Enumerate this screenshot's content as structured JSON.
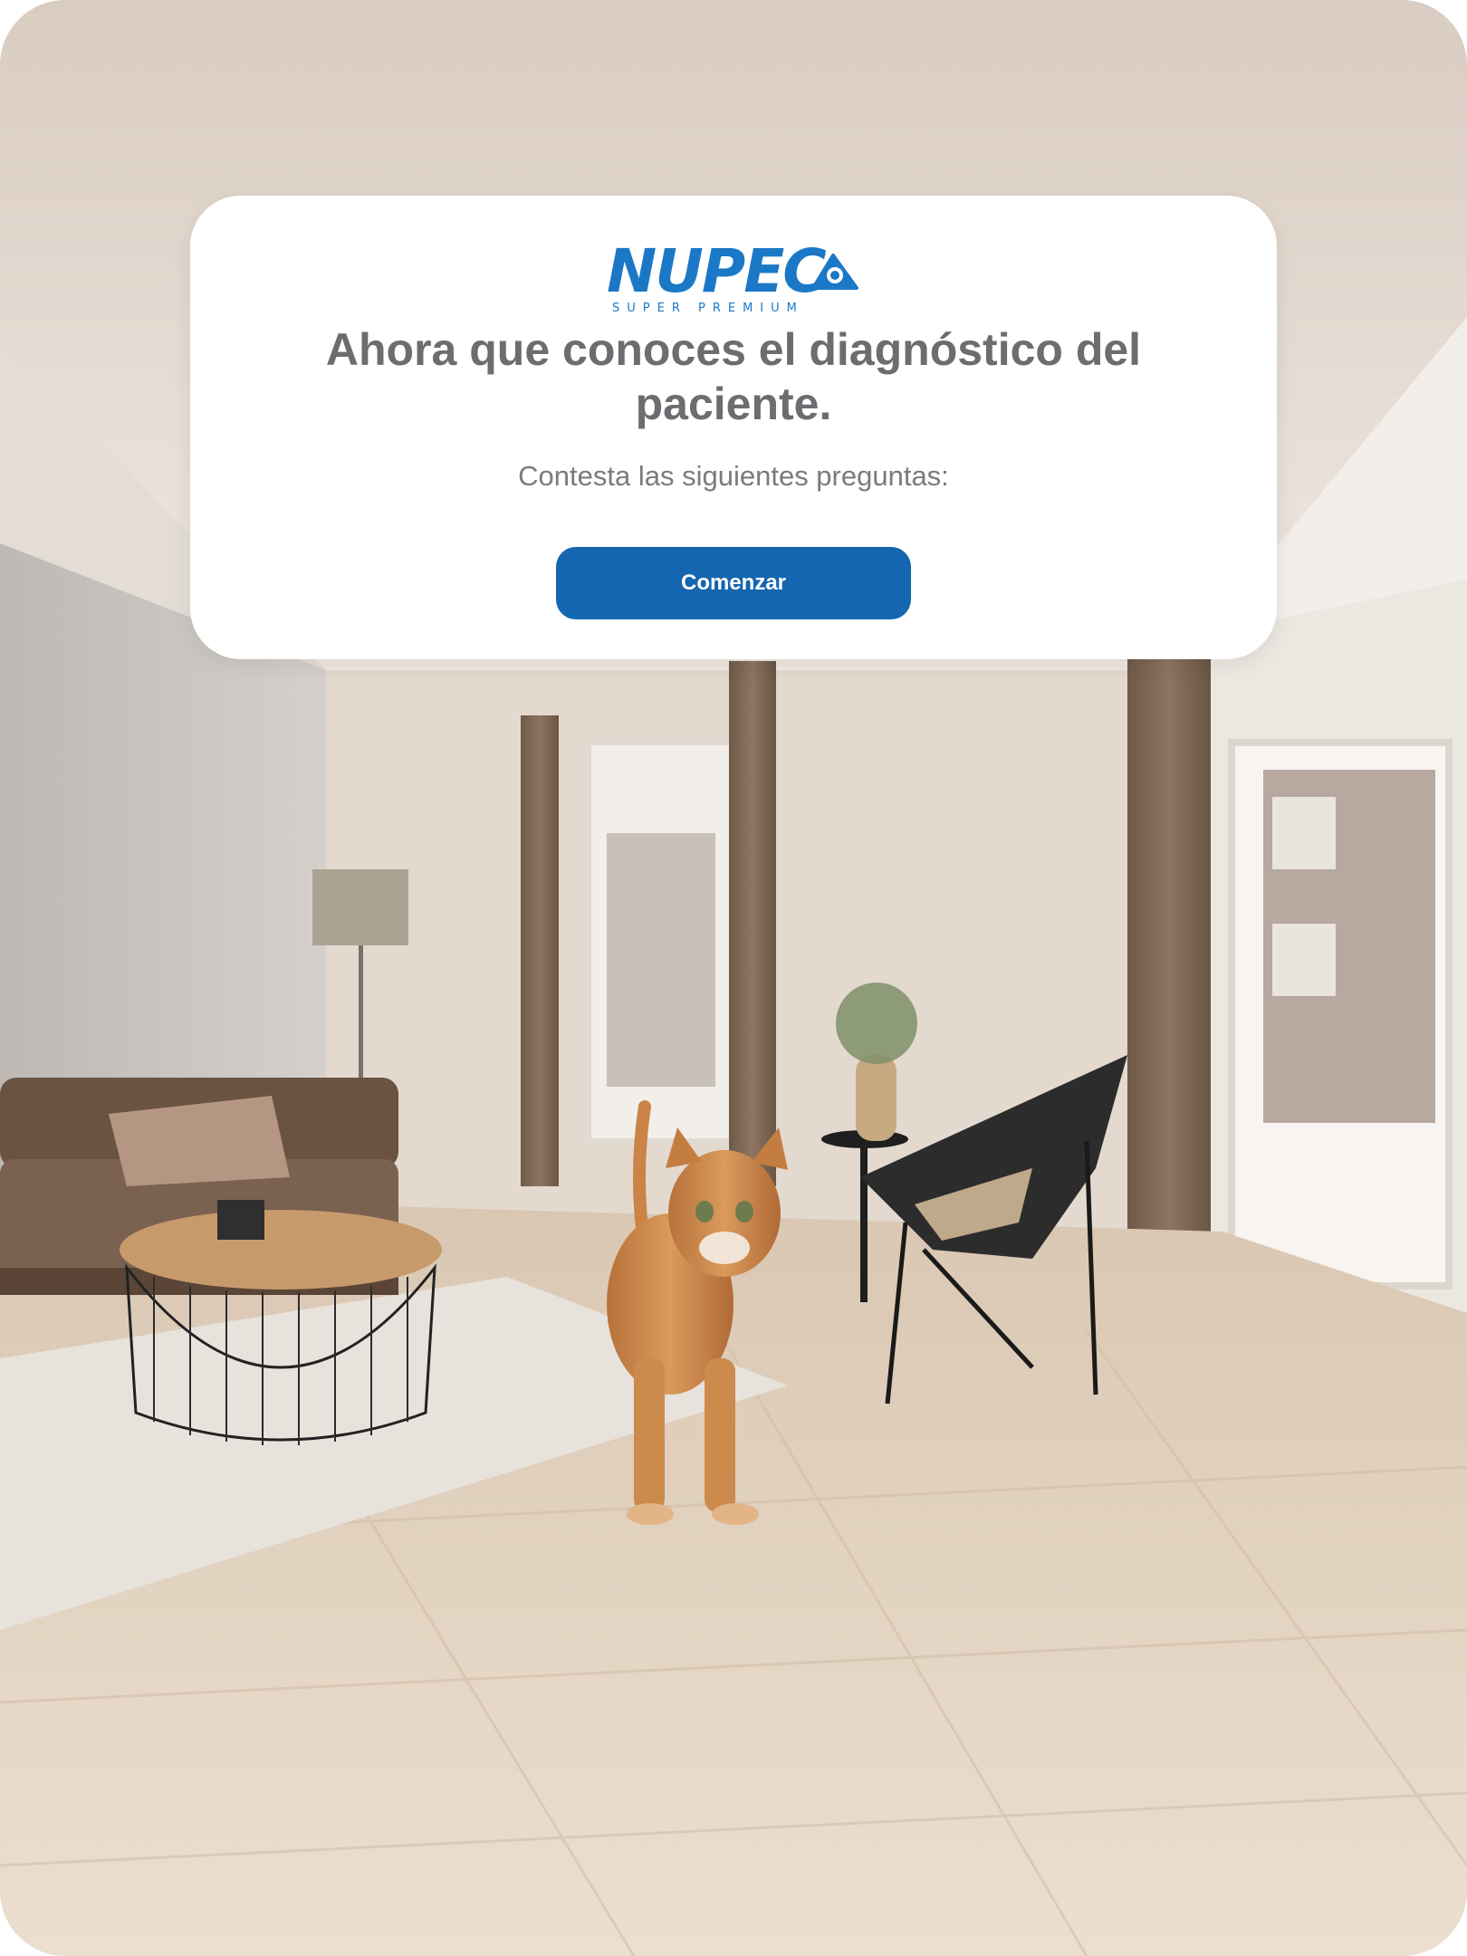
{
  "brand": {
    "logo_text": "NUPEC",
    "logo_tagline": "SUPER PREMIUM",
    "logo_mark": "MR",
    "accent_color": "#1b78c6",
    "button_color": "#1466b0"
  },
  "dialog": {
    "title": "Ahora que conoces el diagnóstico del paciente.",
    "subtitle": "Contesta las siguientes preguntas:",
    "start_button_label": "Comenzar"
  },
  "scene": {
    "background_icon": "living-room-photo",
    "subject_icon": "orange-tabby-cat-icon"
  }
}
